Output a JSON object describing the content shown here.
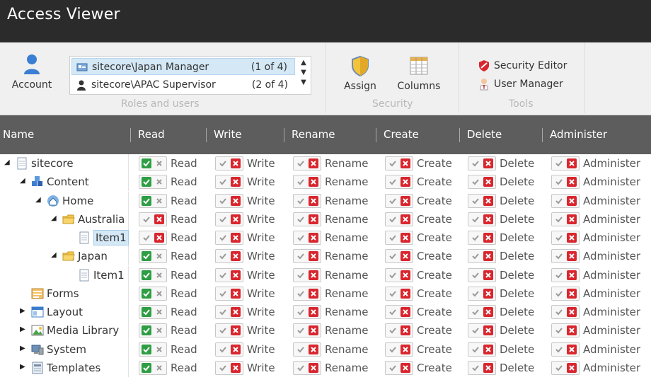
{
  "app": {
    "title": "Access Viewer"
  },
  "ribbon": {
    "account_label": "Account",
    "roles": [
      {
        "name": "sitecore\\Japan Manager",
        "count": "(1 of 4)",
        "icon": "role-icon",
        "selected": true
      },
      {
        "name": "sitecore\\APAC Supervisor",
        "count": "(2 of 4)",
        "icon": "user-icon",
        "selected": false
      }
    ],
    "roles_group_label": "Roles and users",
    "assign_label": "Assign",
    "columns_label": "Columns",
    "security_group_label": "Security",
    "security_editor_label": "Security Editor",
    "user_manager_label": "User Manager",
    "tools_group_label": "Tools"
  },
  "grid": {
    "columns": [
      "Name",
      "Read",
      "Write",
      "Rename",
      "Create",
      "Delete",
      "Administer"
    ],
    "rows": [
      {
        "name": "sitecore",
        "icon": "page-icon",
        "expander": "expanded",
        "read": "allow"
      },
      {
        "name": "Content",
        "icon": "content-icon",
        "expander": "expanded",
        "read": "allow"
      },
      {
        "name": "Home",
        "icon": "home-icon",
        "expander": "expanded",
        "read": "allow"
      },
      {
        "name": "Australia",
        "icon": "folder-icon",
        "expander": "expanded",
        "read": "deny"
      },
      {
        "name": "Item1",
        "icon": "page-icon",
        "expander": "none",
        "read": "deny",
        "selected": true
      },
      {
        "name": "Japan",
        "icon": "folder-icon",
        "expander": "expanded",
        "read": "allow"
      },
      {
        "name": "Item1",
        "icon": "page-icon",
        "expander": "none",
        "read": "allow"
      },
      {
        "name": "Forms",
        "icon": "forms-icon",
        "expander": "none",
        "read": "allow"
      },
      {
        "name": "Layout",
        "icon": "layout-icon",
        "expander": "collapsed",
        "read": "allow"
      },
      {
        "name": "Media Library",
        "icon": "media-icon",
        "expander": "collapsed",
        "read": "allow"
      },
      {
        "name": "System",
        "icon": "system-icon",
        "expander": "collapsed",
        "read": "allow"
      },
      {
        "name": "Templates",
        "icon": "templates-icon",
        "expander": "collapsed",
        "read": "allow"
      }
    ]
  },
  "colors": {
    "allow": "#2e9e44",
    "deny": "#d9262e",
    "header": "#5d5d5d",
    "titlebar": "#2b2b2b"
  }
}
